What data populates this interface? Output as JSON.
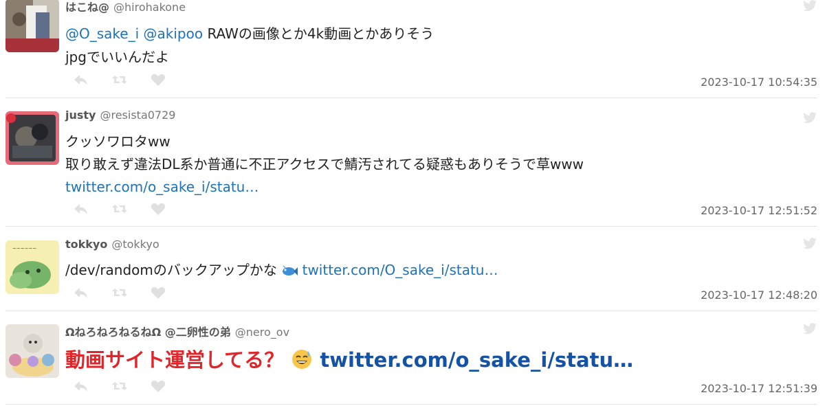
{
  "tweets": [
    {
      "name": "はこね@",
      "handle": "@hirohakone",
      "mention1": "@O_sake_i",
      "mention2": "@akipoo",
      "line1_text": "RAWの画像とか4k動画とかありそう",
      "line2_text": "jpgでいいんだよ",
      "timestamp": "2023-10-17 10:54:35"
    },
    {
      "name": "justy",
      "handle": "@resista0729",
      "line1_text": "クッソワロタww",
      "line2_text": "取り敢えず違法DL系か普通に不正アクセスで鯖汚されてる疑惑もありそうで草www",
      "link_text": "twitter.com/o_sake_i/statu…",
      "timestamp": "2023-10-17 12:51:52"
    },
    {
      "name": "tokkyo",
      "handle": "@tokkyo",
      "line1_text": "/dev/randomのバックアップかな",
      "emoji": "fish",
      "link_text": "twitter.com/O_sake_i/statu…",
      "timestamp": "2023-10-17 12:48:20"
    },
    {
      "name": "ΩねろねろねるねΩ @二卵性の弟",
      "handle": "@nero_ov",
      "big_text": "動画サイト運営してる？",
      "emoji": "grinning-sweat",
      "link_text": "twitter.com/o_sake_i/statu…",
      "timestamp": "2023-10-17 12:51:39"
    }
  ],
  "icons": {
    "reply": "reply-icon",
    "retweet": "retweet-icon",
    "like": "heart-icon",
    "bird": "twitter-bird-icon"
  },
  "colors": {
    "link": "#1d72b8",
    "big_text": "#e0262a",
    "big_link": "#1552a3",
    "action_icons": "#e0e0e0"
  }
}
